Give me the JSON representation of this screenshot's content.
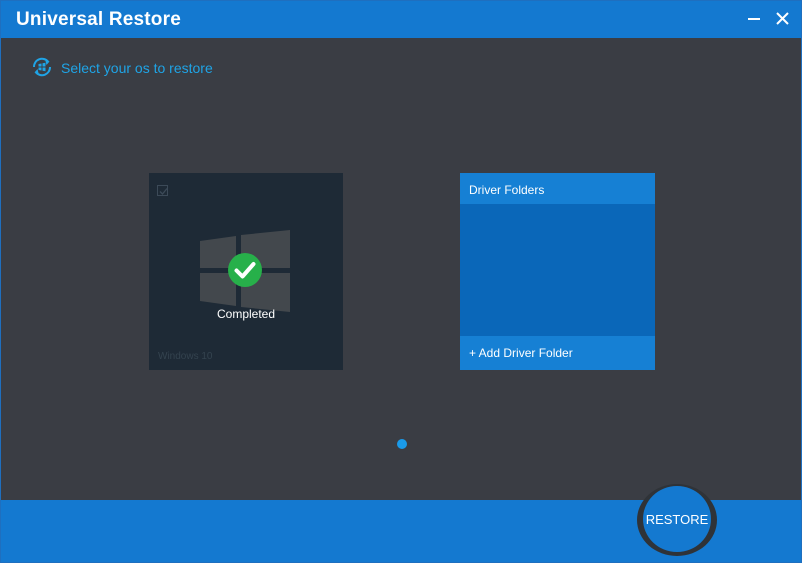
{
  "window": {
    "title": "Universal Restore"
  },
  "header": {
    "hint": "Select your os to restore",
    "icon": "restore-windows-icon"
  },
  "os_tiles": [
    {
      "name": "Windows 10",
      "status": "Completed",
      "selected": true
    }
  ],
  "drivers": {
    "title": "Driver Folders",
    "add_label": "+ Add Driver Folder"
  },
  "footer": {
    "restore_label": "RESTORE"
  },
  "colors": {
    "accent": "#1479d0",
    "background": "#3a3d44",
    "hint_text": "#1fa4e6",
    "completed_green": "#27b04a"
  }
}
